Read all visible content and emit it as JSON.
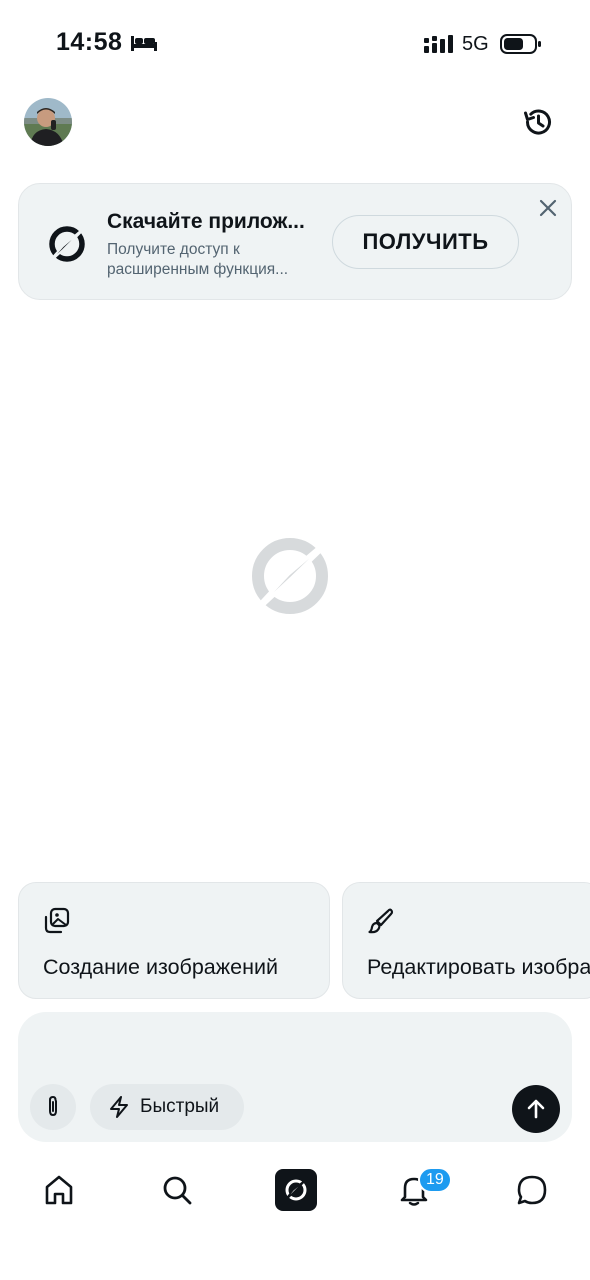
{
  "status_bar": {
    "time": "14:58",
    "network": "5G",
    "icons": [
      "sleep-icon",
      "signal-icon",
      "battery-icon"
    ]
  },
  "header": {
    "avatar": "user-avatar",
    "history_icon": "history-icon"
  },
  "promo": {
    "title": "Скачайте прилож...",
    "subtitle": "Получите доступ к расширенным функция...",
    "button_label": "ПОЛУЧИТЬ",
    "close_icon": "close-icon"
  },
  "suggestions": [
    {
      "label": "Создание изображений",
      "icon": "image-stack-icon"
    },
    {
      "label": "Редактировать изображение",
      "icon": "brush-icon"
    }
  ],
  "composer": {
    "attach_icon": "paperclip-icon",
    "mode_label": "Быстрый",
    "mode_icon": "lightning-icon",
    "send_icon": "arrow-up-icon"
  },
  "bottom_nav": {
    "items": [
      "home-icon",
      "search-icon",
      "grok-icon",
      "bell-icon",
      "chat-icon"
    ],
    "notifications_badge": "19"
  },
  "colors": {
    "background": "#ffffff",
    "surface": "#eff3f4",
    "text": "#0f1419",
    "muted": "#536471",
    "badge": "#1d9bf0"
  }
}
